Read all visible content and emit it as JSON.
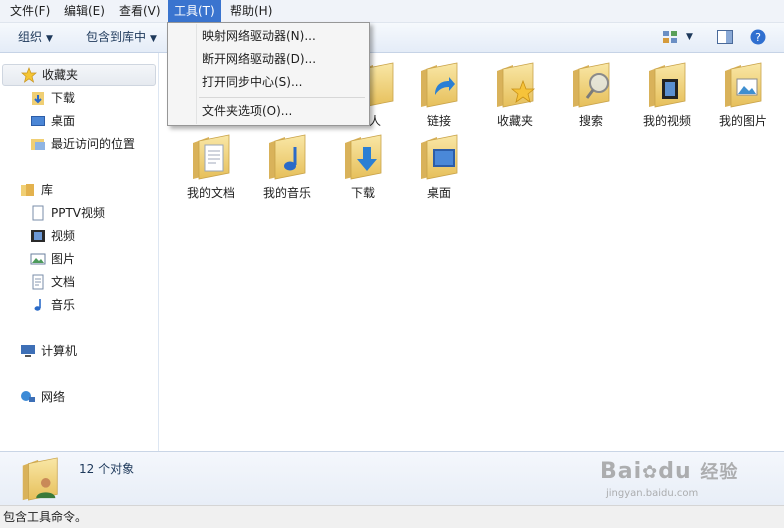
{
  "menubar": {
    "items": [
      "文件(F)",
      "编辑(E)",
      "查看(V)",
      "工具(T)",
      "帮助(H)"
    ],
    "active_index": 3
  },
  "toolbar": {
    "organize_label": "组织",
    "include_library_label": "包含到库中"
  },
  "tools_menu": {
    "items": [
      "映射网络驱动器(N)...",
      "断开网络驱动器(D)...",
      "打开同步中心(S)...",
      "文件夹选项(O)..."
    ]
  },
  "sidebar": {
    "favorites": {
      "header": "收藏夹",
      "items": [
        "下载",
        "桌面",
        "最近访问的位置"
      ]
    },
    "libraries": {
      "header": "库",
      "items": [
        "PPTV视频",
        "视频",
        "图片",
        "文档",
        "音乐"
      ]
    },
    "computer": "计算机",
    "network": "网络"
  },
  "main": {
    "row1": [
      "人",
      "链接",
      "收藏夹",
      "搜索",
      "我的视频",
      "我的图片"
    ],
    "row2": [
      "我的文档",
      "我的音乐",
      "下载",
      "桌面"
    ]
  },
  "details": {
    "count": "12 个对象"
  },
  "statusbar": {
    "text": "包含工具命令。"
  },
  "watermark": {
    "brand": "Bai",
    "brand2": "du",
    "cn": "经验",
    "url": "jingyan.baidu.com"
  },
  "colors": {
    "menu_highlight": "#3a74cf",
    "toolbar_text": "#1e395b",
    "folder": "#f2d27a"
  }
}
